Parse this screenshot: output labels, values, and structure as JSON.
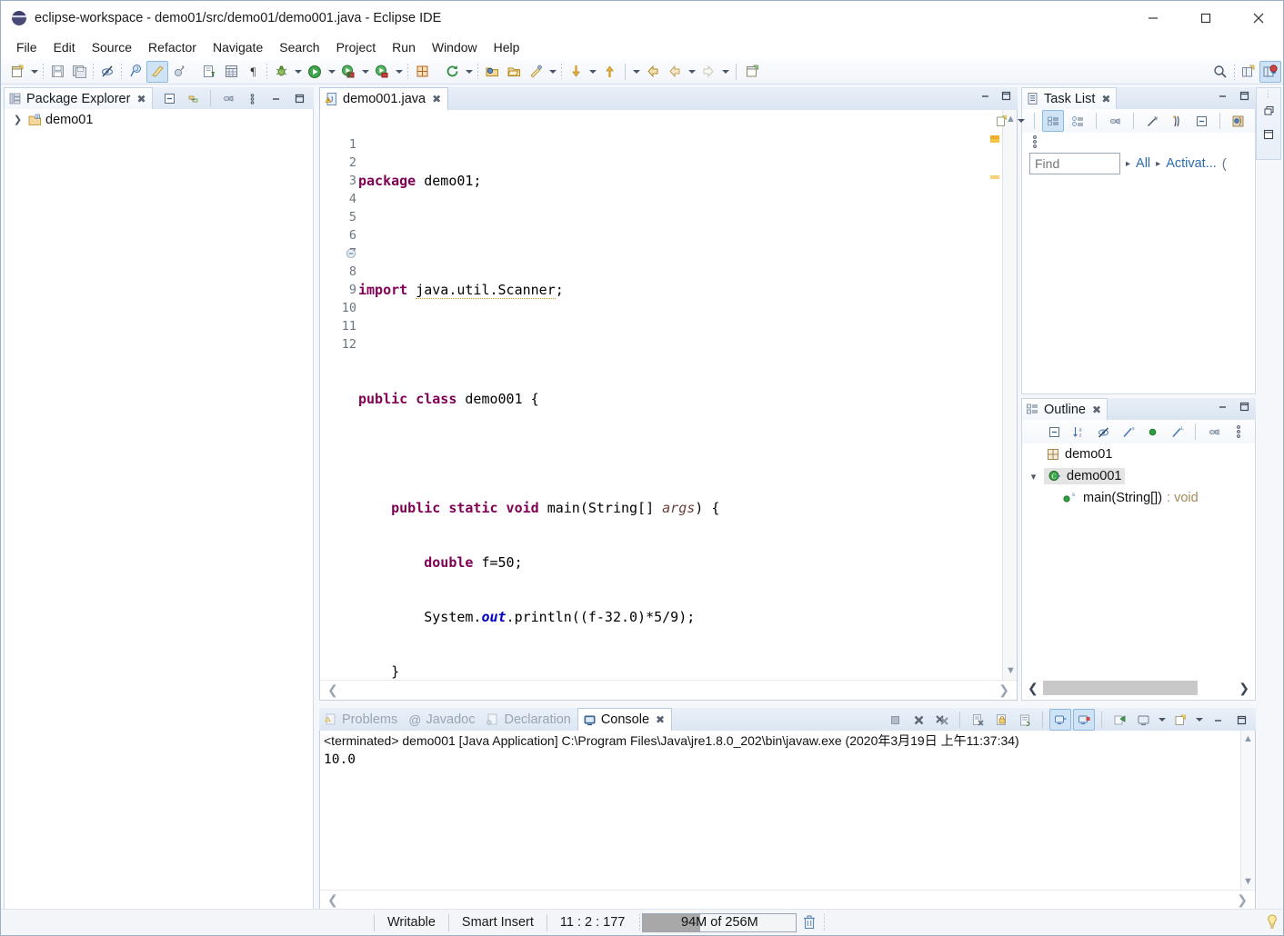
{
  "window": {
    "title": "eclipse-workspace - demo01/src/demo01/demo001.java - Eclipse IDE",
    "app_icon": "eclipse-icon",
    "minimize": "—",
    "maximize": "□",
    "close": "✕"
  },
  "menu": {
    "items": [
      {
        "label": "File"
      },
      {
        "label": "Edit"
      },
      {
        "label": "Source"
      },
      {
        "label": "Refactor"
      },
      {
        "label": "Navigate"
      },
      {
        "label": "Search"
      },
      {
        "label": "Project"
      },
      {
        "label": "Run"
      },
      {
        "label": "Window"
      },
      {
        "label": "Help"
      }
    ]
  },
  "toolbar": {
    "icons": [
      "new-wizard-icon",
      "save-icon",
      "save-all-icon",
      "skip-breakpoints-icon",
      "new-java-project-icon",
      "toggle-mark-occurrences-icon",
      "external-tools-icon",
      "build-all-icon",
      "open-task-icon",
      "paragraph-icon",
      "debug-icon",
      "run-icon",
      "run-last-tool-icon",
      "external-tools-run-icon",
      "new-package-icon",
      "refresh-icon",
      "open-type-icon",
      "open-task-repository-icon",
      "search-icon",
      "next-annotation-icon",
      "previous-annotation-icon",
      "back-icon",
      "forward-icon",
      "pin-editor-icon"
    ],
    "right_icons": [
      "search-icon",
      "open-perspective-icon",
      "java-perspective-icon"
    ]
  },
  "package_explorer": {
    "title": "Package Explorer",
    "tools": [
      "collapse-all-icon",
      "link-with-editor-icon",
      "view-menu-icon",
      "minimize-icon",
      "maximize-icon"
    ],
    "tree": [
      {
        "label": "demo01",
        "icon": "java-project-icon",
        "expanded": false
      }
    ]
  },
  "editor": {
    "tab": {
      "label": "demo001.java",
      "icon": "java-file-warning-icon",
      "close": "✕"
    },
    "lines": [
      {
        "n": "1",
        "text": "package demo01;"
      },
      {
        "n": "2",
        "text": ""
      },
      {
        "n": "3",
        "text": "import java.util.Scanner;"
      },
      {
        "n": "4",
        "text": ""
      },
      {
        "n": "5",
        "text": "public class demo001 {"
      },
      {
        "n": "6",
        "text": ""
      },
      {
        "n": "7",
        "text": "    public static void main(String[] args) {"
      },
      {
        "n": "8",
        "text": "        double f=50;"
      },
      {
        "n": "9",
        "text": "        System.out.println((f-32.0)*5/9);"
      },
      {
        "n": "10",
        "text": "    }"
      },
      {
        "n": "11",
        "text": "}"
      },
      {
        "n": "12",
        "text": ""
      }
    ],
    "warning_line": "3",
    "current_line": "11",
    "fold_marker_line": "7"
  },
  "task_list": {
    "title": "Task List",
    "tools": [
      "new-task-icon",
      "dropdown-icon",
      "categorized-icon",
      "scheduled-icon",
      "focus-icon",
      "synchronize-icon",
      "presentation-icon",
      "collapse-all-icon",
      "view-menu-icon"
    ],
    "find_placeholder": "Find",
    "find_value": "",
    "filter_all": "All",
    "filter_activate": "Activat...",
    "menu_icon": "view-menu-icon"
  },
  "outline": {
    "title": "Outline",
    "tools": [
      "collapse-all-icon",
      "sort-icon",
      "hide-fields-icon",
      "hide-static-icon",
      "hide-non-public-icon",
      "hide-local-types-icon",
      "link-editor-icon",
      "view-menu-icon"
    ],
    "items": [
      {
        "label": "demo01",
        "icon": "package-icon",
        "indent": 0,
        "selected": false,
        "suffix": ""
      },
      {
        "label": "demo001",
        "icon": "class-icon",
        "indent": 0,
        "selected": true,
        "suffix": "",
        "twisty": "⌄"
      },
      {
        "label": "main(String[])",
        "icon": "public-method-icon",
        "indent": 1,
        "selected": false,
        "suffix": " : void"
      }
    ]
  },
  "console": {
    "tabs": [
      {
        "label": "Problems",
        "icon": "problems-icon",
        "active": false
      },
      {
        "label": "Javadoc",
        "icon": "javadoc-icon",
        "active": false
      },
      {
        "label": "Declaration",
        "icon": "declaration-icon",
        "active": false
      },
      {
        "label": "Console",
        "icon": "console-icon",
        "active": true
      }
    ],
    "tools": [
      "terminate-icon",
      "remove-launch-icon",
      "remove-all-launches-icon",
      "clear-console-icon",
      "scroll-lock-icon",
      "word-wrap-icon",
      "show-console-on-output-icon",
      "show-console-on-error-icon",
      "pin-console-icon",
      "display-console-icon",
      "dropdown-icon",
      "new-console-view-icon",
      "dropdown-icon",
      "minimize-icon",
      "maximize-icon"
    ],
    "header": "<terminated> demo001 [Java Application] C:\\Program Files\\Java\\jre1.8.0_202\\bin\\javaw.exe (2020年3月19日 上午11:37:34)",
    "output": "10.0"
  },
  "status_bar": {
    "writable": "Writable",
    "insert_mode": "Smart Insert",
    "position": "11 : 2 : 177",
    "memory": "94M of 256M",
    "memory_percent": 37,
    "trash_icon": "trash-icon",
    "tip_icon": "tip-icon"
  },
  "colors": {
    "keyword": "#7f0055",
    "field": "#0000c0",
    "parameter": "#6a3e3e",
    "link": "#2b6cb0",
    "tab_active_bg": "#ffffff",
    "selection": "#e4e4e4",
    "warning": "#f5c242"
  }
}
